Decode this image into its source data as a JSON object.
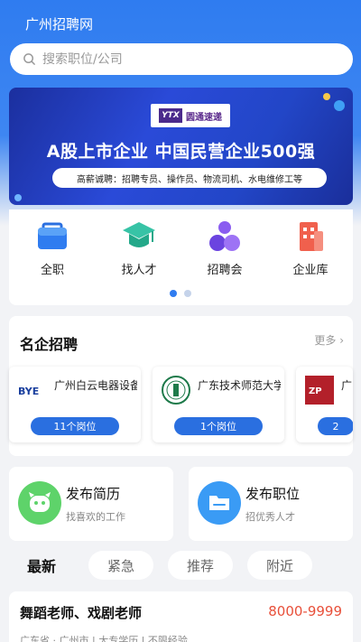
{
  "app": {
    "title": "广州招聘网"
  },
  "search": {
    "placeholder": "搜索职位/公司"
  },
  "banner": {
    "logo_mark": "YTX",
    "logo_name": "圆通速递",
    "headline": "A股上市企业  中国民营企业500强",
    "pill": "高薪诚聘：招聘专员、操作员、物流司机、水电维修工等"
  },
  "categories": [
    {
      "label": "全职",
      "icon": "briefcase-icon"
    },
    {
      "label": "找人才",
      "icon": "graduation-cap-icon"
    },
    {
      "label": "招聘会",
      "icon": "people-icon"
    },
    {
      "label": "企业库",
      "icon": "building-icon"
    }
  ],
  "famous": {
    "title": "名企招聘",
    "more": "更多",
    "companies": [
      {
        "name": "广州白云电器设备",
        "count": "11个岗位",
        "logo": "BYE"
      },
      {
        "name": "广东技术师范大学",
        "count": "1个岗位",
        "logo": ""
      },
      {
        "name": "广",
        "count": "2",
        "logo": "ZP"
      }
    ]
  },
  "publish": [
    {
      "title": "发布简历",
      "sub": "找喜欢的工作",
      "icon": "resume-icon"
    },
    {
      "title": "发布职位",
      "sub": "招优秀人才",
      "icon": "folder-icon"
    }
  ],
  "tabs": [
    "最新",
    "紧急",
    "推荐",
    "附近"
  ],
  "job": {
    "title": "舞蹈老师、戏剧老师",
    "salary": "8000-9999",
    "meta": "广东省 · 广州市 | 大专学历 | 不限经验"
  },
  "colors": {
    "primary": "#2f7cf0",
    "salary": "#e8503a"
  }
}
